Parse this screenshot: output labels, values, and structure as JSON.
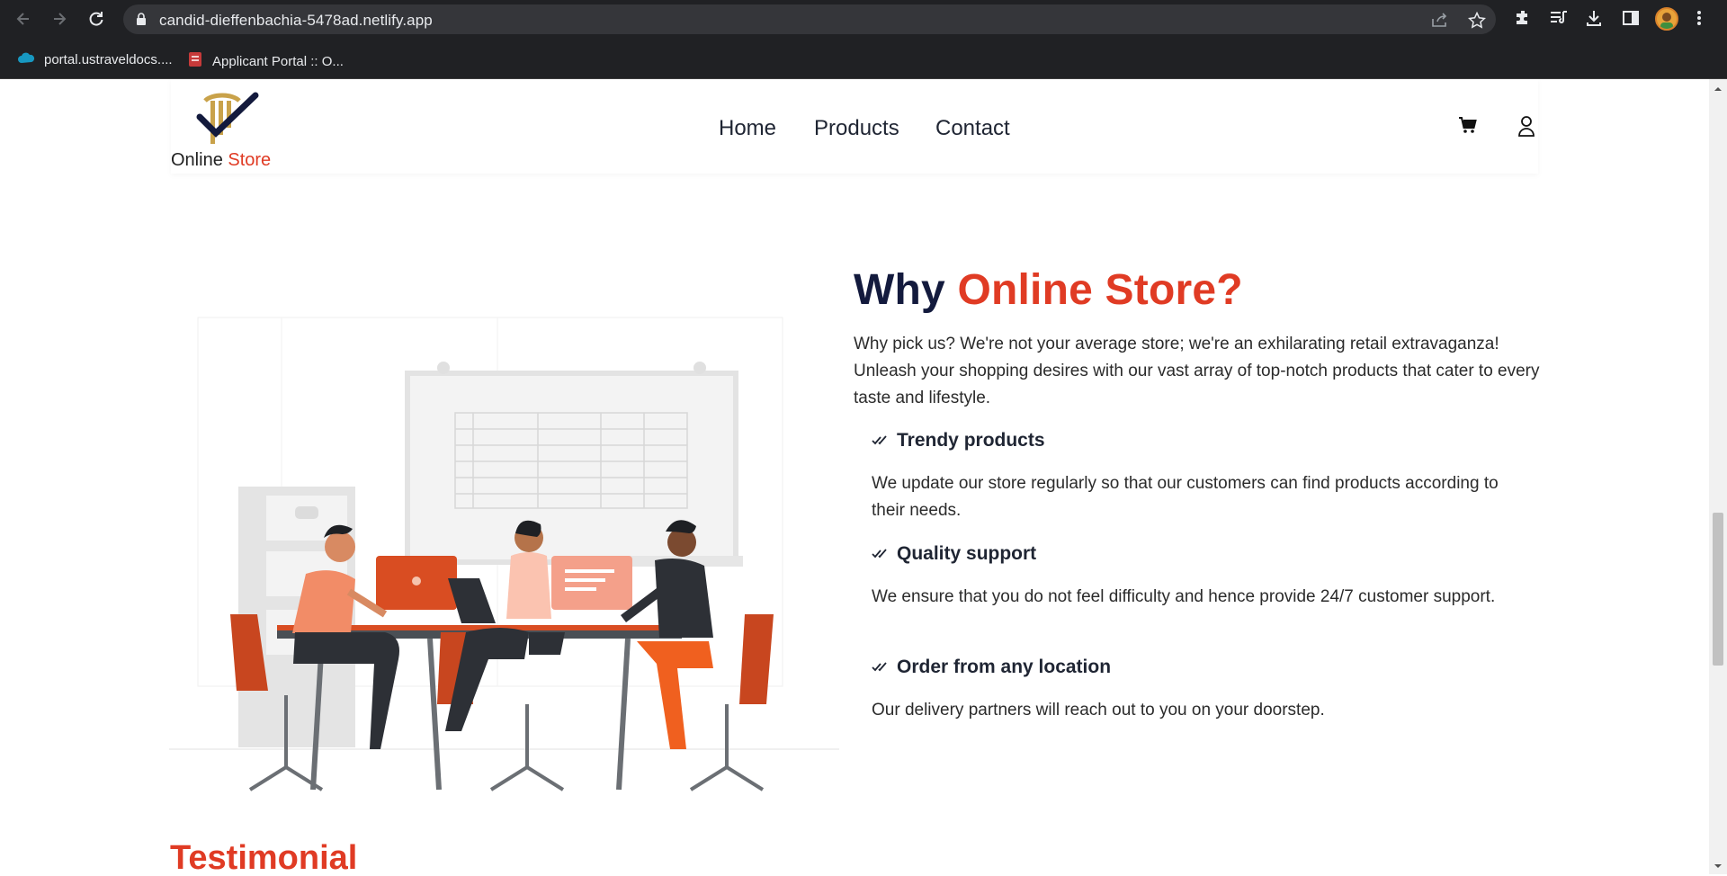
{
  "browser": {
    "url": "candid-dieffenbachia-5478ad.netlify.app",
    "bookmarks": [
      {
        "label": "portal.ustraveldocs...."
      },
      {
        "label": "Applicant Portal :: O..."
      }
    ]
  },
  "nav": {
    "brand_main": "Online",
    "brand_accent": "Store",
    "menu": [
      "Home",
      "Products",
      "Contact"
    ]
  },
  "why": {
    "heading_part1": "Why",
    "heading_part2": "Online Store?",
    "intro": "Why pick us? We're not your average store; we're an exhilarating retail extravaganza! Unleash your shopping desires with our vast array of top-notch products that cater to every taste and lifestyle.",
    "features": [
      {
        "title": "Trendy products",
        "desc": "We update our store regularly so that our customers can find products according to their needs."
      },
      {
        "title": "Quality support",
        "desc": "We ensure that you do not feel difficulty and hence provide 24/7 customer support."
      },
      {
        "title": "Order from any location",
        "desc": "Our delivery partners will reach out to you on your doorstep."
      }
    ]
  },
  "testimonial": {
    "title": "Testimonial"
  },
  "colors": {
    "accent": "#e03b24",
    "navy": "#131a3d",
    "chrome": "#202124"
  }
}
